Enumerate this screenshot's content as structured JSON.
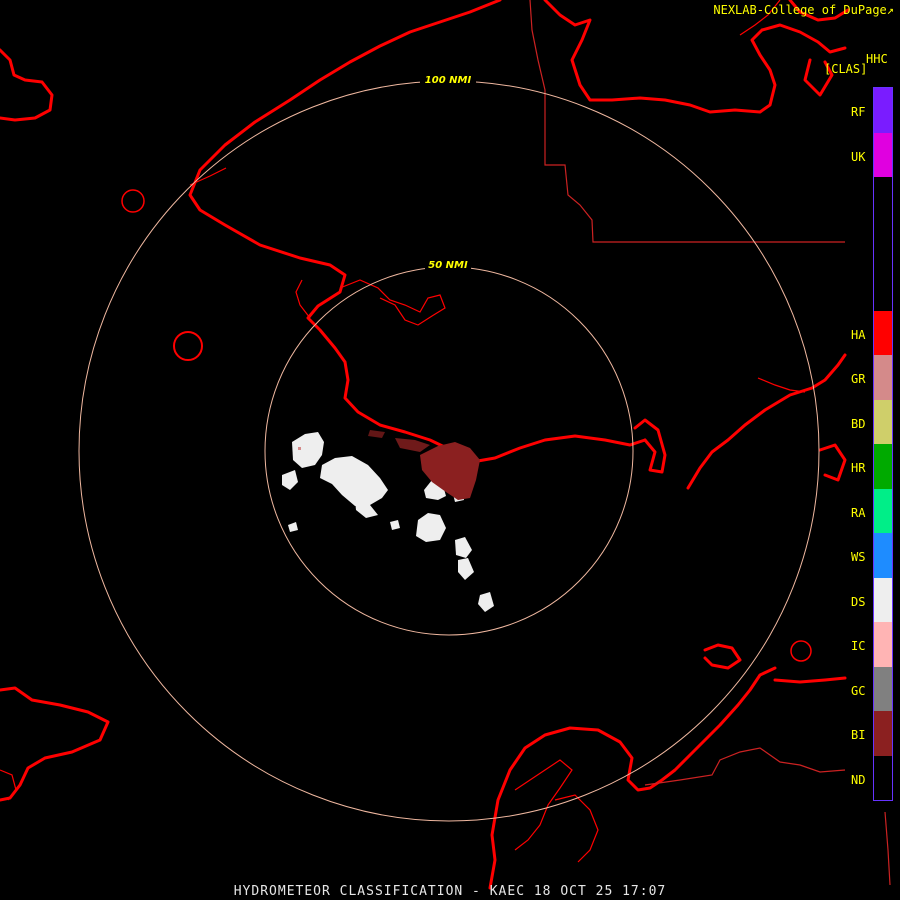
{
  "credit": "NEXLAB-College of DuPage",
  "credit_icon": "external-link-icon",
  "product_code": "HHC",
  "product_class": "[CLAS]",
  "footer": "HYDROMETEOR CLASSIFICATION - KAEC 18 OCT 25 17:07",
  "range_rings": [
    {
      "label": "50 NMI",
      "nmi": 50
    },
    {
      "label": "100 NMI",
      "nmi": 100
    }
  ],
  "legend": [
    {
      "code": "RF",
      "color": "#7a1cff"
    },
    {
      "code": "UK",
      "color": "#e000e0"
    },
    {
      "code": "",
      "color": "#000000"
    },
    {
      "code": "",
      "color": "#000000"
    },
    {
      "code": "",
      "color": "#000000"
    },
    {
      "code": "HA",
      "color": "#ff0000"
    },
    {
      "code": "GR",
      "color": "#d48a8a"
    },
    {
      "code": "BD",
      "color": "#cfcf6a"
    },
    {
      "code": "HR",
      "color": "#00aa00"
    },
    {
      "code": "RA",
      "color": "#00ee88"
    },
    {
      "code": "WS",
      "color": "#1e8cff"
    },
    {
      "code": "DS",
      "color": "#eeeeee"
    },
    {
      "code": "IC",
      "color": "#ffb4b4"
    },
    {
      "code": "GC",
      "color": "#808080"
    },
    {
      "code": "BI",
      "color": "#8b2020"
    },
    {
      "code": "ND",
      "color": "#000000"
    }
  ],
  "colors": {
    "background": "#000000",
    "coastline": "#ff0000",
    "border": "#cc2222",
    "ring": "#f0b8a0",
    "legend_frame": "#6633ff",
    "text": "#ffff00"
  }
}
